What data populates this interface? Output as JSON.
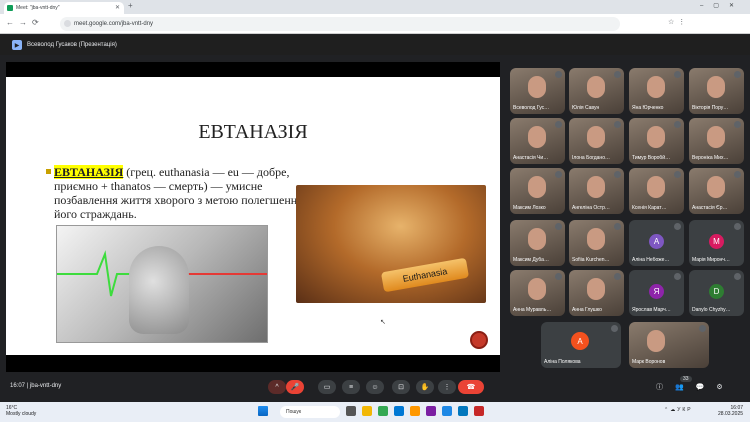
{
  "browser": {
    "tab_title": "Meet: \"jba-vntt-dny\"",
    "url": "meet.google.com/jba-vntt-dny"
  },
  "meet": {
    "presenter_label": "Всеволод Гусаков (Презентація)",
    "time": "16:07",
    "meeting_code": "jba-vntt-dny",
    "participant_count": "33"
  },
  "slide": {
    "title": "ЕВТАНАЗІЯ",
    "term": "ЕВТАНАЗІЯ",
    "definition": " (грец. euthanasia — eu — добре, приємно + thanatos — смерть) — умисне позбавлення життя хворого з метою полегшення його страждань.",
    "vial_label": "Euthanasia"
  },
  "participants": [
    {
      "name": "Всеволод Гус…",
      "type": "cam"
    },
    {
      "name": "Юлія Савун",
      "type": "cam"
    },
    {
      "name": "Яна Юрченко",
      "type": "cam"
    },
    {
      "name": "Вікторія Пору…",
      "type": "cam"
    },
    {
      "name": "Анастасія Чи…",
      "type": "cam"
    },
    {
      "name": "Ілона Богдано…",
      "type": "cam"
    },
    {
      "name": "Тимур Воробй…",
      "type": "cam"
    },
    {
      "name": "Вероніка Мих…",
      "type": "cam"
    },
    {
      "name": "Максим Лозко",
      "type": "cam"
    },
    {
      "name": "Ангеліна Остр…",
      "type": "cam"
    },
    {
      "name": "Ксенія Карат…",
      "type": "cam"
    },
    {
      "name": "Анастасія Єр…",
      "type": "cam"
    },
    {
      "name": "Максим Дуба…",
      "type": "cam"
    },
    {
      "name": "Sofiia Kurchen…",
      "type": "cam"
    },
    {
      "name": "Аліна Небоже…",
      "type": "avatar",
      "letter": "А",
      "color": "#7e57c2"
    },
    {
      "name": "Марія Миронч…",
      "type": "avatar",
      "letter": "М",
      "color": "#d81b60"
    },
    {
      "name": "Анна Муравль…",
      "type": "cam"
    },
    {
      "name": "Анна Глушко",
      "type": "cam"
    },
    {
      "name": "Ярослав Марч…",
      "type": "avatar",
      "letter": "Я",
      "color": "#8e24aa"
    },
    {
      "name": "Danylo Chyzhy…",
      "type": "avatar",
      "letter": "D",
      "color": "#2e7d32"
    },
    {
      "name": "Аліна Полякова",
      "type": "avatar",
      "letter": "А",
      "color": "#f4511e"
    },
    {
      "name": "Марк Воронов",
      "type": "cam"
    }
  ],
  "taskbar": {
    "weather_temp": "16°C",
    "weather_desc": "Mostly cloudy",
    "search_placeholder": "Пошук",
    "lang": "УКР",
    "time": "16:07",
    "date": "28.03.2025"
  }
}
